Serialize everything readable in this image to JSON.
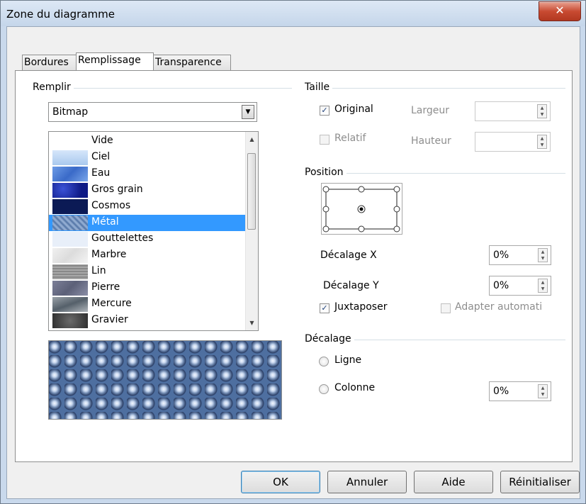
{
  "window": {
    "title": "Zone du diagramme",
    "close_glyph": "✕"
  },
  "tabs": [
    {
      "label": "Bordures"
    },
    {
      "label": "Remplissage",
      "active": true
    },
    {
      "label": "Transparence"
    }
  ],
  "fill": {
    "group_label": "Remplir",
    "type_value": "Bitmap",
    "items": [
      {
        "label": "Vide",
        "color": "#ffffff"
      },
      {
        "label": "Ciel",
        "color": "#bcd6f4"
      },
      {
        "label": "Eau",
        "color": "#4d7fd8"
      },
      {
        "label": "Gros grain",
        "color": "#1b2a9b"
      },
      {
        "label": "Cosmos",
        "color": "#0a1650"
      },
      {
        "label": "Métal",
        "color": "#7c9bc6",
        "selected": true
      },
      {
        "label": "Gouttelettes",
        "color": "#e3ecf8"
      },
      {
        "label": "Marbre",
        "color": "#e6e6e6"
      },
      {
        "label": "Lin",
        "color": "#9b9b9b"
      },
      {
        "label": "Pierre",
        "color": "#6b6f88"
      },
      {
        "label": "Mercure",
        "color": "#7e858c"
      },
      {
        "label": "Gravier",
        "color": "#4b4b4b"
      }
    ],
    "selected_color": "#3399ff"
  },
  "size": {
    "group_label": "Taille",
    "original": {
      "label": "Original",
      "checked": true
    },
    "relative": {
      "label": "Relatif",
      "checked": false
    },
    "width_label": "Largeur",
    "height_label": "Hauteur"
  },
  "position": {
    "group_label": "Position",
    "offset_x_label": "Décalage X",
    "offset_x_value": "0%",
    "offset_y_label": "Décalage Y",
    "offset_y_value": "0%",
    "tile": {
      "label": "Juxtaposer",
      "checked": true
    },
    "autofit": {
      "label": "Adapter automati",
      "checked": false
    }
  },
  "offset": {
    "group_label": "Décalage",
    "row_label": "Ligne",
    "column_label": "Colonne",
    "value": "0%"
  },
  "buttons": {
    "ok": "OK",
    "cancel": "Annuler",
    "help": "Aide",
    "reset": "Réinitialiser"
  }
}
